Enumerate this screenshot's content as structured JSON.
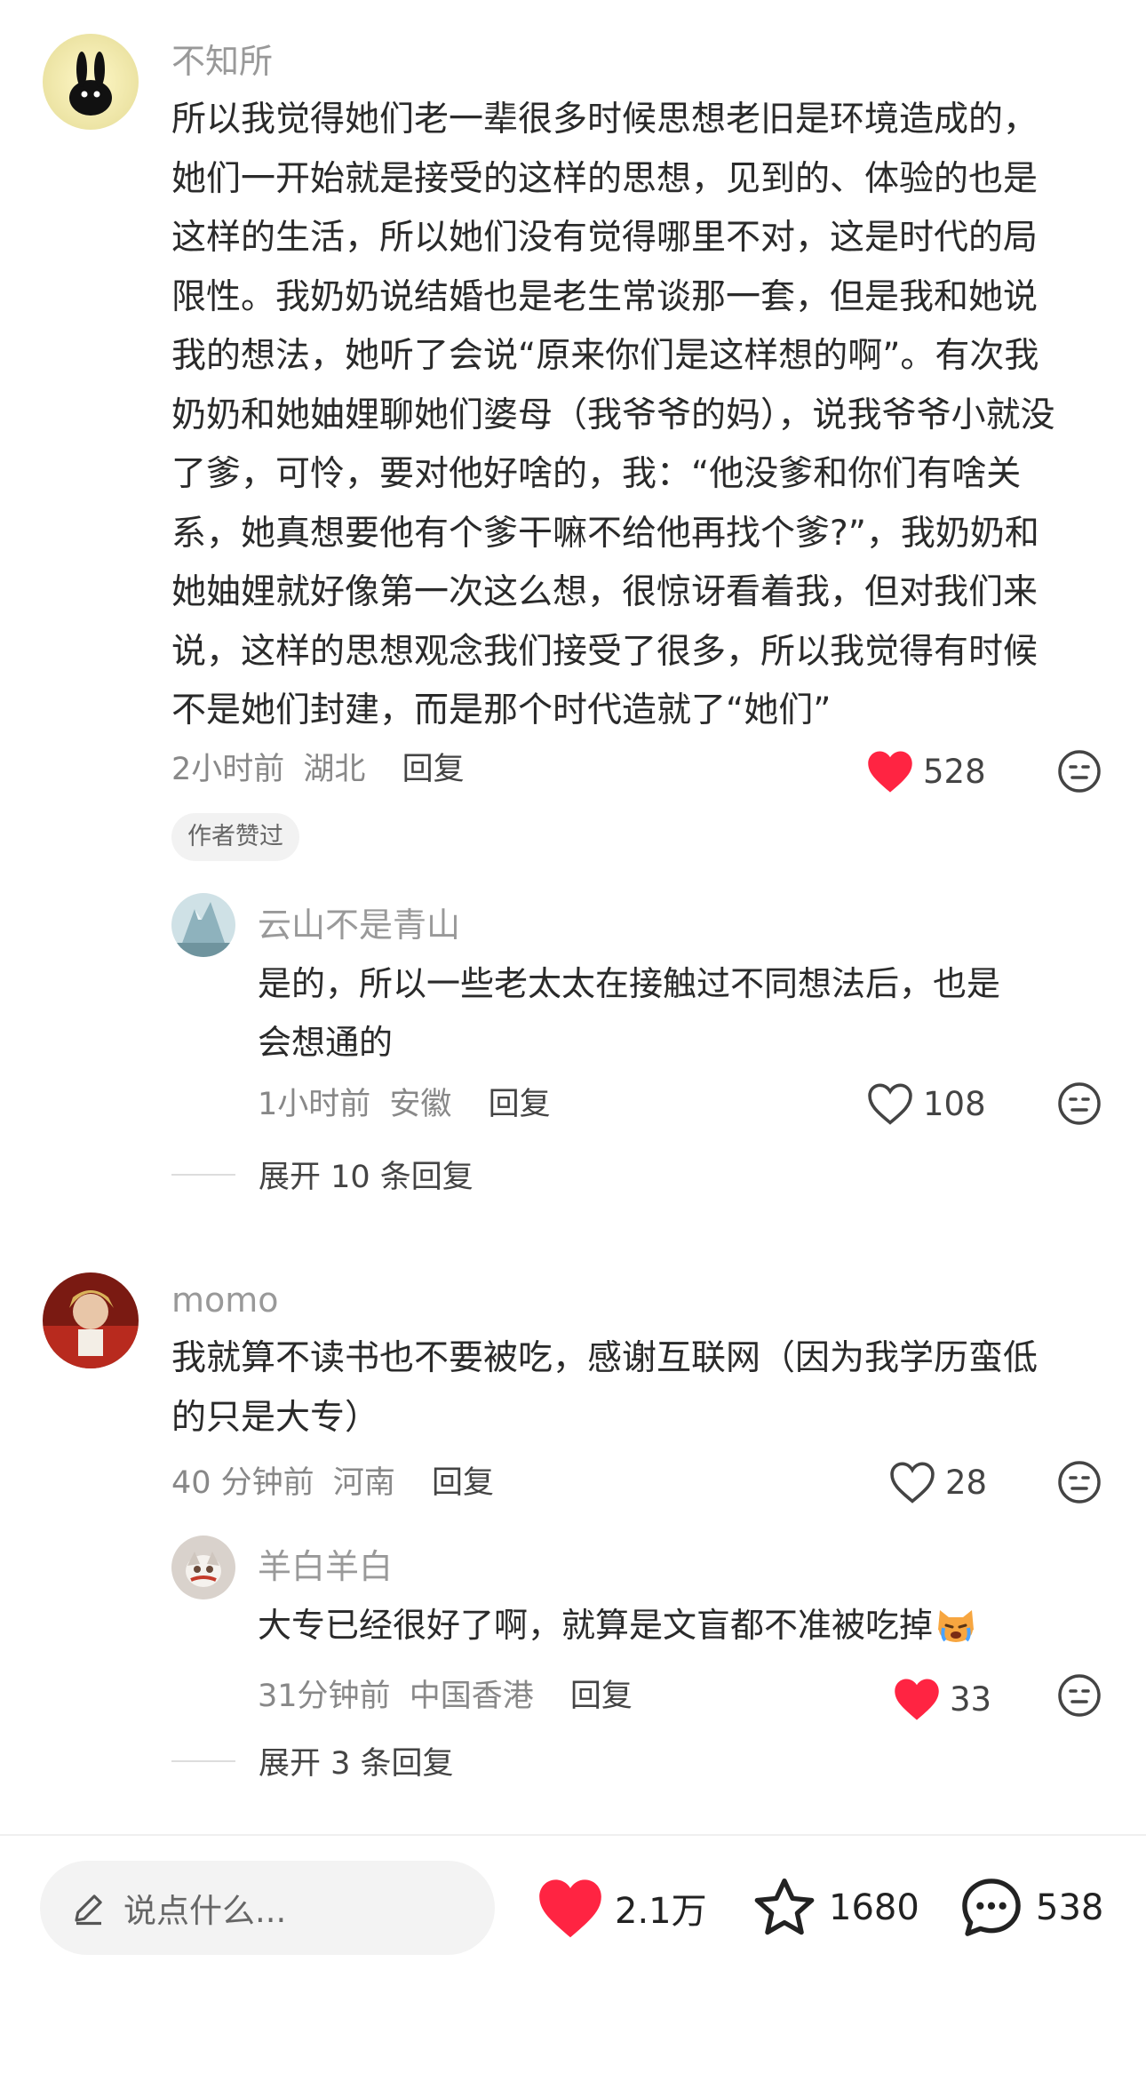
{
  "comments": [
    {
      "username": "不知所",
      "lines": [
        "所以我觉得她们老一辈很多时候思想老旧是环境造成的，",
        "她们一开始就是接受的这样的思想，见到的、体验的也是",
        "这样的生活，所以她们没有觉得哪里不对，这是时代的局",
        "限性。我奶奶说结婚也是老生常谈那一套，但是我和她说",
        "我的想法，她听了会说“原来你们是这样想的啊”。有次我",
        "奶奶和她妯娌聊她们婆母（我爷爷的妈），说我爷爷小就没",
        "了爹，可怜，要对他好啥的，我：“他没爹和你们有啥关",
        "系，她真想要他有个爹干嘛不给他再找个爹?”，我奶奶和",
        "她妯娌就好像第一次这么想，很惊讶看着我，但对我们来",
        "说，这样的思想观念我们接受了很多，所以我觉得有时候",
        "不是她们封建，而是那个时代造就了“她们”"
      ],
      "time": "2小时前",
      "location": "湖北",
      "reply_label": "回复",
      "likes": "528",
      "liked": true,
      "author_tag": "作者赞过",
      "replies": [
        {
          "username": "云山不是青山",
          "lines": [
            "是的，所以一些老太太在接触过不同想法后，也是",
            "会想通的"
          ],
          "time": "1小时前",
          "location": "安徽",
          "reply_label": "回复",
          "likes": "108",
          "liked": false
        }
      ],
      "expand_label": "展开 10 条回复"
    },
    {
      "username": "momo",
      "lines": [
        "我就算不读书也不要被吃，感谢互联网（因为我学历蛮低",
        "的只是大专）"
      ],
      "time": "40 分钟前",
      "location": "河南",
      "reply_label": "回复",
      "likes": "28",
      "liked": false,
      "replies": [
        {
          "username": "羊白羊白",
          "lines": [
            "大专已经很好了啊，就算是文盲都不准被吃掉"
          ],
          "time": "31分钟前",
          "location": "中国香港",
          "reply_label": "回复",
          "likes": "33",
          "liked": true
        }
      ],
      "expand_label": "展开 3 条回复"
    }
  ],
  "footer": {
    "input_placeholder": "说点什么...",
    "likes": "2.1万",
    "favorites": "1680",
    "comments": "538"
  },
  "colors": {
    "accent_red": "#ff2442",
    "text_primary": "#2a2a2a",
    "text_secondary": "#999999"
  },
  "icons": [
    "pencil-icon",
    "heart-icon",
    "heart-outline-icon",
    "star-icon",
    "chat-bubble-icon",
    "dislike-face-icon",
    "crying-cat-emoji"
  ]
}
